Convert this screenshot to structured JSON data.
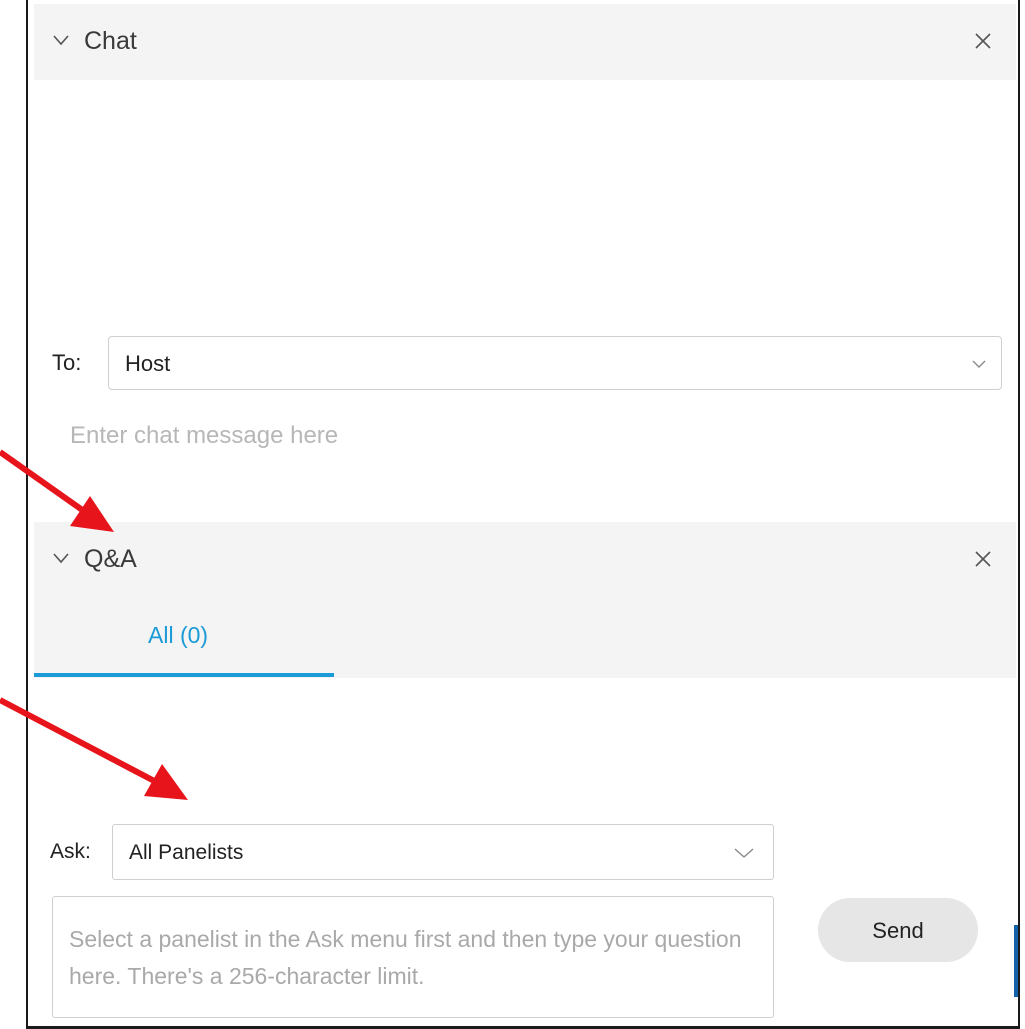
{
  "chat": {
    "title": "Chat",
    "to_label": "To:",
    "to_value": "Host",
    "message_placeholder": "Enter chat message here"
  },
  "qa": {
    "title": "Q&A",
    "tabs": [
      {
        "label": "All (0)",
        "active": true
      }
    ],
    "ask_label": "Ask:",
    "ask_value": "All Panelists",
    "question_placeholder": "Select a panelist in the Ask menu first and then type your question here. There's a 256-character limit.",
    "send_label": "Send"
  },
  "icons": {
    "collapse": "chevron-down-icon",
    "close": "close-icon",
    "dropdown": "chevron-down-icon"
  },
  "colors": {
    "accent": "#1a9ad6",
    "annotation_arrow": "#e8141b",
    "header_bg": "#f4f4f4"
  }
}
